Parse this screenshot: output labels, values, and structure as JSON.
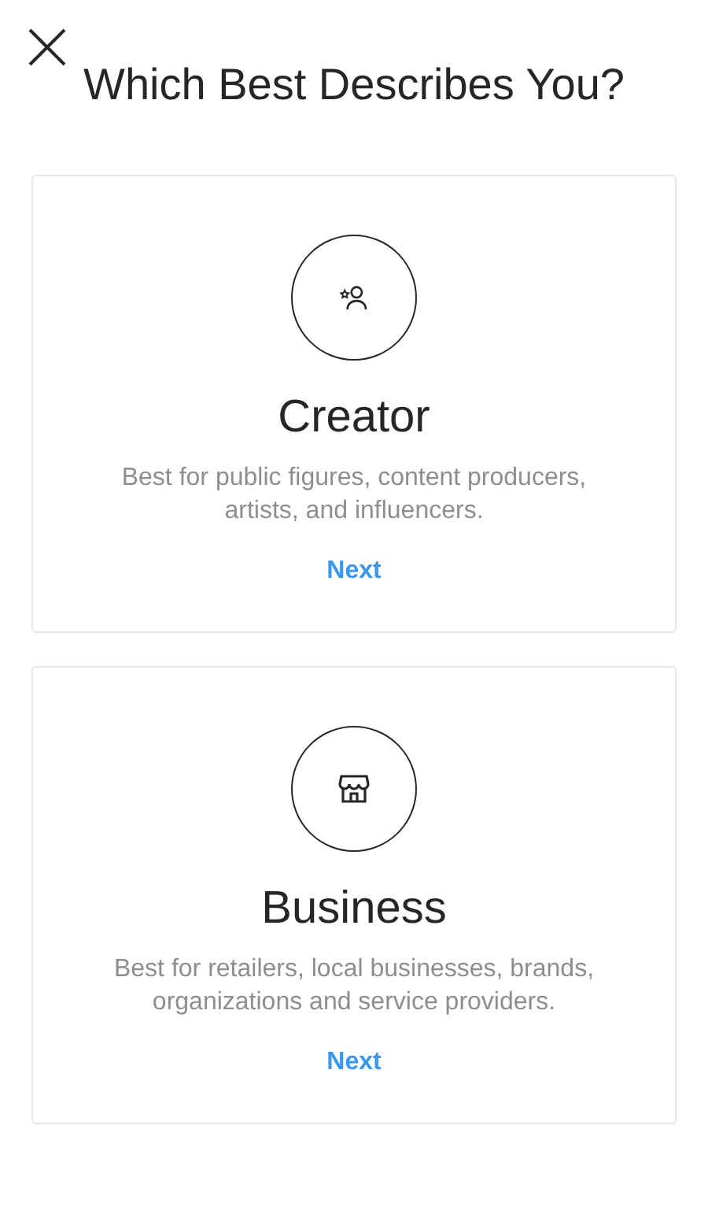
{
  "title": "Which Best Describes You?",
  "options": [
    {
      "kind": "creator",
      "name": "Creator",
      "description": "Best for public figures, content producers, artists, and influencers.",
      "action": "Next"
    },
    {
      "kind": "business",
      "name": "Business",
      "description": "Best for retailers, local businesses, brands, organizations and service providers.",
      "action": "Next"
    }
  ]
}
